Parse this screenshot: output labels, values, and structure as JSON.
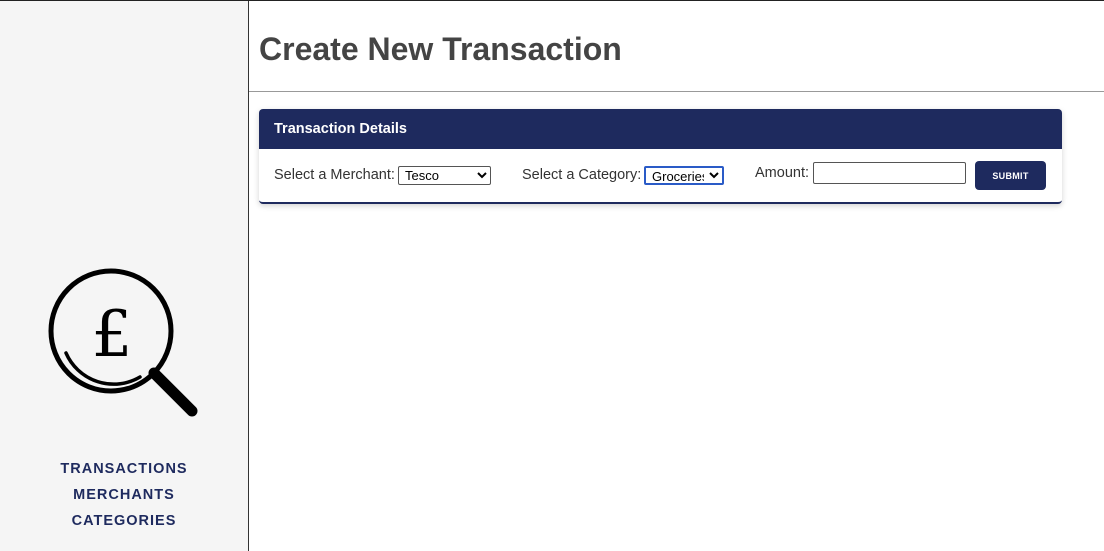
{
  "sidebar": {
    "logo_icon": "magnifier-pound-icon",
    "nav": [
      "TRANSACTIONS",
      "MERCHANTS",
      "CATEGORIES"
    ]
  },
  "main": {
    "title": "Create New Transaction",
    "card": {
      "header": "Transaction Details",
      "merchant_label": "Select a Merchant:",
      "merchant_value": "Tesco",
      "category_label": "Select a Category:",
      "category_value": "Groceries",
      "amount_label": "Amount:",
      "amount_value": "",
      "submit_label": "SUBMIT"
    }
  },
  "colors": {
    "accent": "#1e2a5e",
    "sidebar_bg": "#f5f5f5",
    "title": "#444444"
  }
}
